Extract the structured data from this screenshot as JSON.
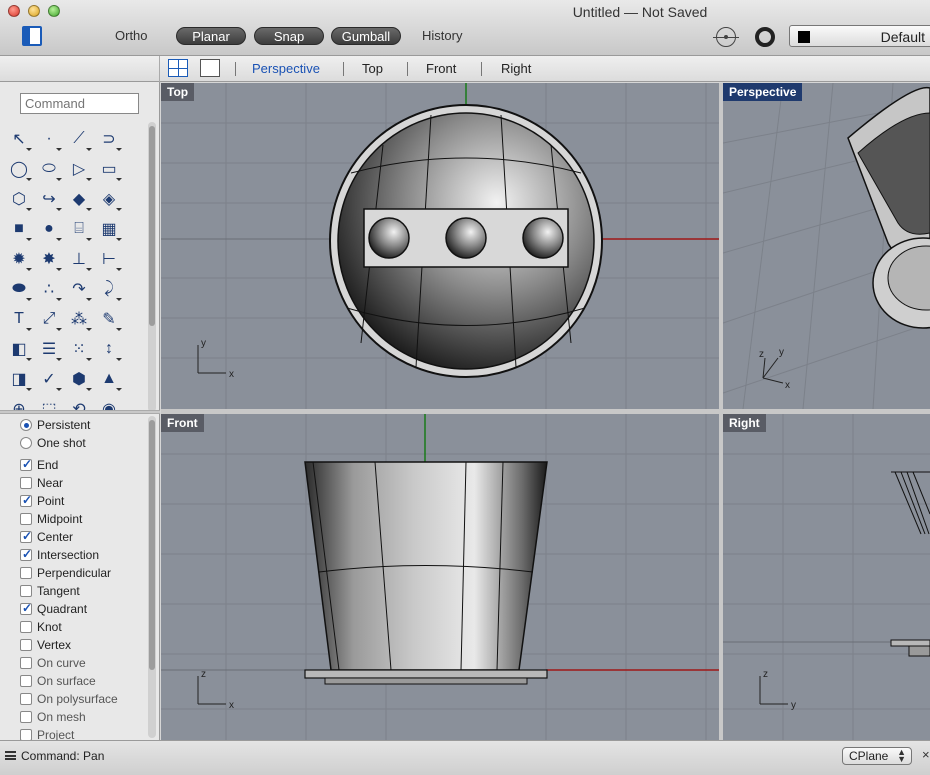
{
  "window": {
    "title": "Untitled — Not Saved"
  },
  "toolbar": {
    "ortho_label": "Ortho",
    "planar_label": "Planar",
    "snap_label": "Snap",
    "gumball_label": "Gumball",
    "history_label": "History",
    "layer_name": "Default"
  },
  "view_tabs": {
    "perspective": "Perspective",
    "top": "Top",
    "front": "Front",
    "right": "Right"
  },
  "command": {
    "placeholder": "Command"
  },
  "osnaps": [
    {
      "label": "Persistent",
      "type": "radio",
      "checked": true
    },
    {
      "label": "One shot",
      "type": "radio",
      "checked": false
    },
    {
      "label": "End",
      "type": "check",
      "checked": true
    },
    {
      "label": "Near",
      "type": "check",
      "checked": false
    },
    {
      "label": "Point",
      "type": "check",
      "checked": true
    },
    {
      "label": "Midpoint",
      "type": "check",
      "checked": false
    },
    {
      "label": "Center",
      "type": "check",
      "checked": true
    },
    {
      "label": "Intersection",
      "type": "check",
      "checked": true
    },
    {
      "label": "Perpendicular",
      "type": "check",
      "checked": false
    },
    {
      "label": "Tangent",
      "type": "check",
      "checked": false
    },
    {
      "label": "Quadrant",
      "type": "check",
      "checked": true
    },
    {
      "label": "Knot",
      "type": "check",
      "checked": false
    },
    {
      "label": "Vertex",
      "type": "check",
      "checked": false
    },
    {
      "label": "On curve",
      "type": "check",
      "checked": false
    },
    {
      "label": "On surface",
      "type": "check",
      "checked": false
    },
    {
      "label": "On polysurface",
      "type": "check",
      "checked": false
    },
    {
      "label": "On mesh",
      "type": "check",
      "checked": false
    },
    {
      "label": "Project",
      "type": "check",
      "checked": false
    }
  ],
  "viewports": {
    "top": "Top",
    "perspective": "Perspective",
    "front": "Front",
    "right": "Right"
  },
  "status": {
    "command_text": "Command:  Pan",
    "cplane": "CPlane"
  }
}
